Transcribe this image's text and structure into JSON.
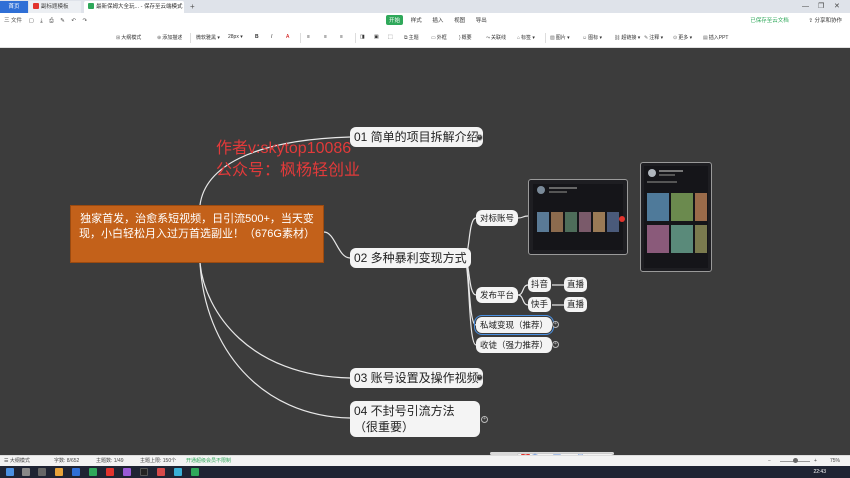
{
  "tabs": {
    "home": "首页",
    "tab1": "副标题模板",
    "tab2": "最新保姆大全玩...  - 保存至云端模式",
    "add": "+"
  },
  "window": {
    "minimize": "—",
    "restore": "❐",
    "close": "✕"
  },
  "menubar": {
    "file": "三 文件",
    "items": [
      "开始",
      "样式",
      "插入",
      "视图",
      "导出"
    ],
    "active_index": 0,
    "sync_status": "已保存至云文档",
    "share": "分享和协作"
  },
  "ribbon": {
    "add_topic": "大纲模式",
    "add_subtopic": "添加描述",
    "font": "微软雅黑",
    "font_size": "28px",
    "bold": "B",
    "italic": "I",
    "color": "A",
    "theme": "主题",
    "outline": "外框",
    "summary": "概要",
    "relation": "关联线",
    "label": "标签",
    "image": "图片",
    "icon": "图标",
    "link": "超链接",
    "comment": "注释",
    "more": "更多",
    "export": "插入PPT"
  },
  "mindmap": {
    "root": "独家首发，治愈系短视频，日引流500+，当天变现，小白轻松月入过万首选副业！（676G素材）",
    "watermark_line1": "作者v:skytop10086",
    "watermark_line2": "公众号：枫杨轻创业",
    "topic1": "01 简单的项目拆解介绍",
    "topic2": "02 多种暴利变现方式",
    "topic3": "03 账号设置及操作视频",
    "topic4": "04 不封号引流方法（很重要）",
    "sub_target": "对标账号",
    "sub_platform": "发布平台",
    "sub_private": "私域变现（推荐）",
    "sub_collect": "收徒（强力推荐）",
    "leaf_douyin": "抖音",
    "leaf_kuaishou": "快手",
    "leaf_live1": "直播",
    "leaf_live2": "直播",
    "colors": {
      "root_fill": "#c3611a",
      "canvas_bg": "#3c3c3c",
      "node_fill": "#f4f4f4",
      "watermark": "#e23a3a"
    }
  },
  "tray": {
    "label": "中"
  },
  "status": {
    "mode": "大纲模式",
    "words": "字数: 8/652",
    "topics": "主题数: 1/49",
    "limit": "主题上限: 150个",
    "upgrade": "开通超级会员不限制",
    "zoom": "75%"
  },
  "taskbar": {
    "time": "22:43"
  }
}
